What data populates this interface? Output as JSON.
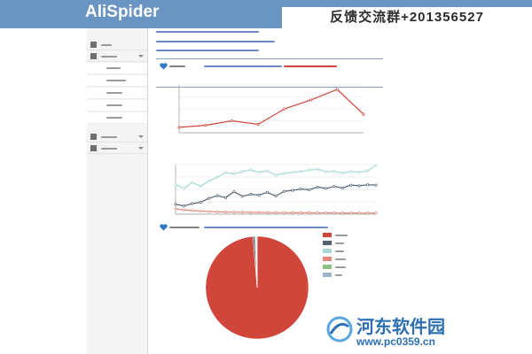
{
  "app": {
    "title": "AliSpider",
    "banner": "反馈交流群+201356527"
  },
  "colors": {
    "header": "#6a95c2",
    "accent": "#d0463b",
    "sidebar": "#f4f4f4"
  },
  "sidebar": {
    "items": [
      {
        "icon": "home-icon"
      },
      {
        "icon": "grid-icon",
        "expanded": true
      },
      {
        "icon": "gear-icon"
      },
      {
        "icon": "settings-icon"
      }
    ],
    "sub_item_count": 5
  },
  "watermark": {
    "name": "河东软件园",
    "url": "www.pc0359.cn"
  },
  "chart_data": [
    {
      "type": "line",
      "series": [
        {
          "color": "#d0463b",
          "values": [
            18000,
            25000,
            40000,
            28000,
            80000,
            110000,
            145000,
            62000
          ]
        }
      ],
      "ylim": [
        0,
        160000
      ],
      "grid": true
    },
    {
      "type": "line",
      "series": [
        {
          "color": "#a7d8d4",
          "values": [
            9000,
            7800,
            9600,
            8500,
            10000,
            11200,
            12600,
            12200,
            12900,
            13400,
            12700,
            13100,
            11800,
            12300,
            12700,
            12900,
            13300,
            13600,
            12800,
            13000,
            12400,
            12900,
            12700,
            13100,
            14800
          ]
        },
        {
          "color": "#55626e",
          "values": [
            3000,
            2500,
            3200,
            3600,
            4800,
            5600,
            5000,
            6800,
            5400,
            6000,
            5800,
            6600,
            5500,
            6900,
            7200,
            7600,
            7400,
            8200,
            7800,
            8400,
            7900,
            8800,
            8600,
            8900,
            8800
          ]
        },
        {
          "color": "#e08a7f",
          "values": [
            1600,
            1300,
            1100,
            900,
            800,
            700,
            650,
            620,
            580,
            560,
            540,
            500,
            480,
            460,
            440,
            430,
            420,
            410,
            400,
            390,
            380,
            370,
            360,
            350,
            340
          ]
        }
      ],
      "ylim": [
        0,
        15000
      ],
      "grid": true
    },
    {
      "type": "pie",
      "slices": [
        {
          "value": 987,
          "color": "#d0463b"
        },
        {
          "value": 6,
          "color": "#55626e"
        },
        {
          "value": 3,
          "color": "#a7d8d4"
        },
        {
          "value": 2,
          "color": "#e08a7f"
        },
        {
          "value": 1,
          "color": "#8dbf86"
        },
        {
          "value": 1,
          "color": "#9cb2c8"
        }
      ]
    }
  ]
}
